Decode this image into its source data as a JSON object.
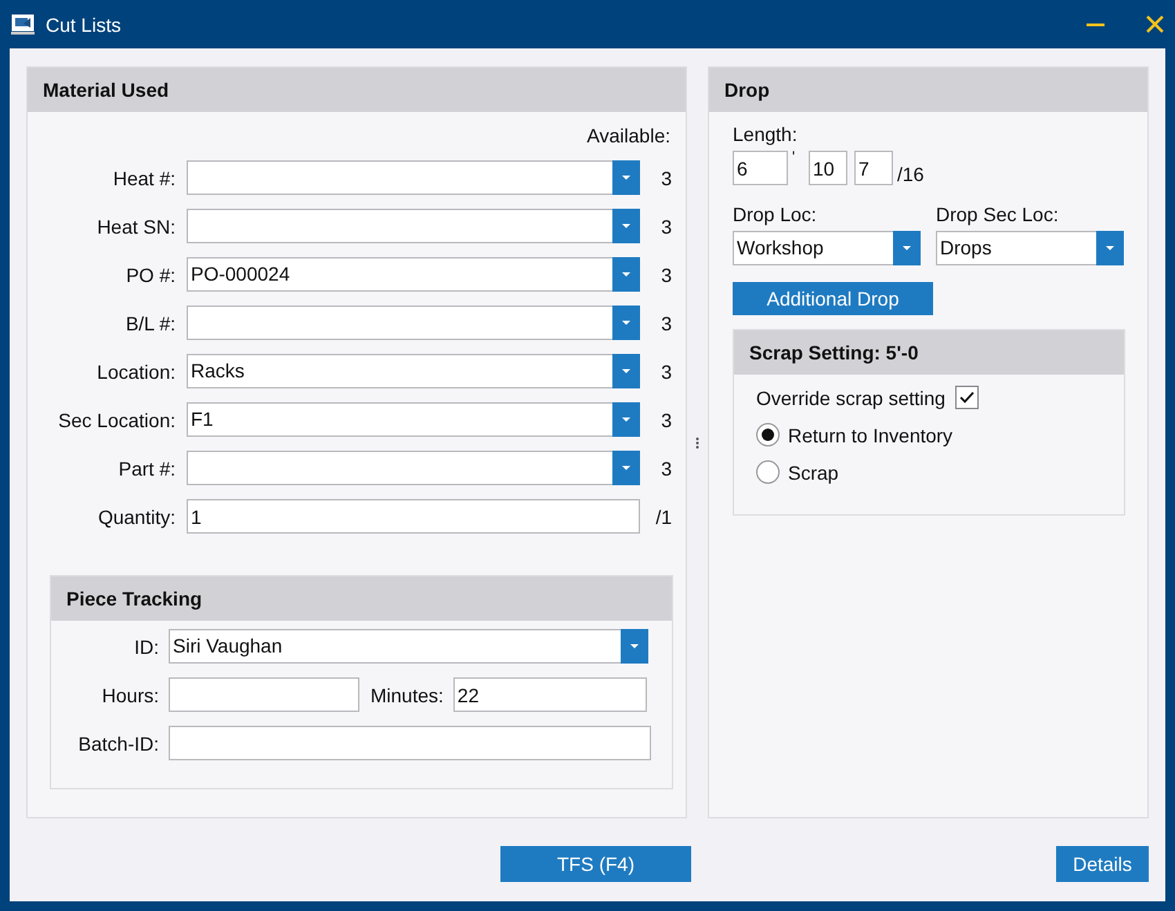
{
  "window": {
    "title": "Cut Lists"
  },
  "material_used": {
    "title": "Material Used",
    "available_label": "Available:",
    "fields": [
      {
        "kind": "combo",
        "label": "Heat #:",
        "available": "3"
      },
      {
        "kind": "combo",
        "label": "Heat SN:",
        "available": "3"
      },
      {
        "kind": "combo",
        "label": "PO #:",
        "value": "PO-000024",
        "available": "3"
      },
      {
        "kind": "combo",
        "label": "B/L #:",
        "available": "3"
      },
      {
        "kind": "combo",
        "label": "Location:",
        "value": "Racks",
        "available": "3"
      },
      {
        "kind": "combo",
        "label": "Sec Location:",
        "value": "F1",
        "available": "3"
      },
      {
        "kind": "combo",
        "label": "Part #:",
        "available": "3"
      },
      {
        "kind": "text",
        "label": "Quantity:",
        "value": "1",
        "available": "/1"
      }
    ]
  },
  "piece_tracking": {
    "title": "Piece Tracking",
    "id": {
      "label": "ID:",
      "value": "Siri Vaughan"
    },
    "hours": {
      "label": "Hours:"
    },
    "minutes": {
      "label": "Minutes:",
      "value": "22"
    },
    "batch_id": {
      "label": "Batch-ID:"
    }
  },
  "drop": {
    "title": "Drop",
    "length": {
      "label": "Length:",
      "feet": "6",
      "feet_mark": "'",
      "inches": "10",
      "fraction": "7",
      "denominator": "/16"
    },
    "drop_loc": {
      "label": "Drop Loc:",
      "value": "Workshop"
    },
    "drop_sec_loc": {
      "label": "Drop Sec Loc:",
      "value": "Drops"
    },
    "additional_drop": "Additional Drop",
    "scrap_setting": {
      "title": "Scrap Setting: 5'-0",
      "override": {
        "label": "Override scrap setting",
        "checked": true
      },
      "options": [
        {
          "label": "Return to Inventory",
          "selected": true
        },
        {
          "label": "Scrap",
          "selected": false
        }
      ]
    }
  },
  "buttons": [
    {
      "label": "TFS (F4)",
      "kind": "center"
    },
    {
      "label": "Details",
      "kind": "right"
    }
  ]
}
